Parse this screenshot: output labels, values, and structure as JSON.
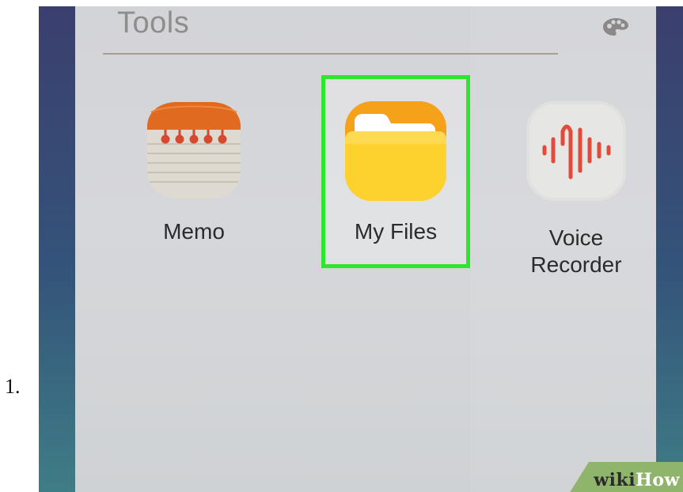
{
  "step": {
    "number": "1."
  },
  "folder": {
    "title": "Tools",
    "palette_icon": "palette-icon"
  },
  "apps": [
    {
      "label": "Memo",
      "icon": "memo-notepad-icon",
      "selected": false
    },
    {
      "label": "My Files",
      "icon": "folder-icon",
      "selected": true
    },
    {
      "label_line1": "Voice",
      "label_line2": "Recorder",
      "icon": "voice-recorder-waveform-icon",
      "selected": false
    }
  ],
  "colors": {
    "highlight": "#2ee62e",
    "folder_yellow": "#fdd22d",
    "folder_orange": "#f6a41a",
    "memo_top": "#df6a21",
    "recorder_red": "#e44c3c"
  },
  "watermark": {
    "part1": "wiki",
    "part2": "How"
  }
}
